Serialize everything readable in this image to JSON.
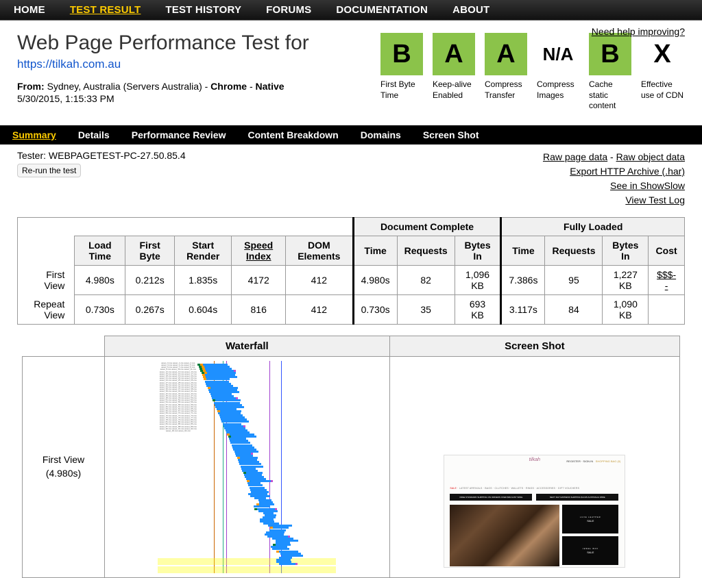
{
  "topnav": {
    "home": "HOME",
    "test_result": "TEST RESULT",
    "test_history": "TEST HISTORY",
    "forums": "FORUMS",
    "documentation": "DOCUMENTATION",
    "about": "ABOUT"
  },
  "help_link": "Need help improving?",
  "page": {
    "title": "Web Page Performance Test for",
    "url": "https://tilkah.com.au",
    "from_label": "From:",
    "from_value": "Sydney, Australia (Servers Australia) - ",
    "browser": "Chrome",
    "sep": " - ",
    "connectivity": "Native",
    "timestamp": "5/30/2015, 1:15:33 PM"
  },
  "grades": [
    {
      "letter": "B",
      "cls": "grade-b",
      "label": "First Byte Time"
    },
    {
      "letter": "A",
      "cls": "grade-a",
      "label": "Keep-alive Enabled"
    },
    {
      "letter": "A",
      "cls": "grade-a",
      "label": "Compress Transfer"
    },
    {
      "letter": "N/A",
      "cls": "grade-na",
      "label": "Compress Images"
    },
    {
      "letter": "B",
      "cls": "grade-b",
      "label": "Cache static content"
    },
    {
      "letter": "X",
      "cls": "grade-x",
      "label": "Effective use of CDN"
    }
  ],
  "subnav": {
    "summary": "Summary",
    "details": "Details",
    "perf_review": "Performance Review",
    "content_breakdown": "Content Breakdown",
    "domains": "Domains",
    "screenshot": "Screen Shot"
  },
  "tester": {
    "prefix": "Tester: ",
    "id": "WEBPAGETEST-PC-27.50.85.4",
    "rerun": "Re-run the test"
  },
  "links": {
    "raw_page": "Raw page data",
    "raw_object": "Raw object data",
    "sep": " - ",
    "har": "Export HTTP Archive (.har)",
    "showslow": "See in ShowSlow",
    "testlog": "View Test Log"
  },
  "metrics": {
    "group_doc": "Document Complete",
    "group_full": "Fully Loaded",
    "cols": {
      "load_time": "Load Time",
      "first_byte": "First Byte",
      "start_render": "Start Render",
      "speed_index": "Speed Index",
      "dom_elements": "DOM Elements",
      "time": "Time",
      "requests": "Requests",
      "bytes_in": "Bytes In",
      "cost": "Cost"
    },
    "rows": [
      {
        "label": "First View",
        "load_time": "4.980s",
        "first_byte": "0.212s",
        "start_render": "1.835s",
        "speed_index": "4172",
        "dom_elements": "412",
        "dc_time": "4.980s",
        "dc_requests": "82",
        "dc_bytes": "1,096 KB",
        "fl_time": "7.386s",
        "fl_requests": "95",
        "fl_bytes": "1,227 KB",
        "cost": "$$$--"
      },
      {
        "label": "Repeat View",
        "load_time": "0.730s",
        "first_byte": "0.267s",
        "start_render": "0.604s",
        "speed_index": "816",
        "dom_elements": "412",
        "dc_time": "0.730s",
        "dc_requests": "35",
        "dc_bytes": "693 KB",
        "fl_time": "3.117s",
        "fl_requests": "84",
        "fl_bytes": "1,090 KB",
        "cost": ""
      }
    ]
  },
  "wf": {
    "header_wf": "Waterfall",
    "header_ss": "Screen Shot",
    "first_view_label": "First View",
    "first_view_time": "(4.980s)"
  },
  "screenshot": {
    "register": "REGISTER · SIGN IN",
    "bag": "SHOPPING BAG (0)",
    "nav": "LATEST ARRIVALS · BAGS · CLUTCHES · WALLETS · RINGS · ACCESSORIES · GIFT VOUCHERS",
    "sale": "SALE",
    "bar1": "FREE STANDARD SHIPPING ON ORDERS OVER $99 AUST WIDE",
    "bar2": "NEXT DAY EXPRESS SHIPPING $14.95 AUSTRALIA WIDE",
    "box1_small": "LUXE LEATHER",
    "box1_big": "SALE",
    "box2_small": "JEWEL BOX",
    "box2_big": "SALE"
  }
}
